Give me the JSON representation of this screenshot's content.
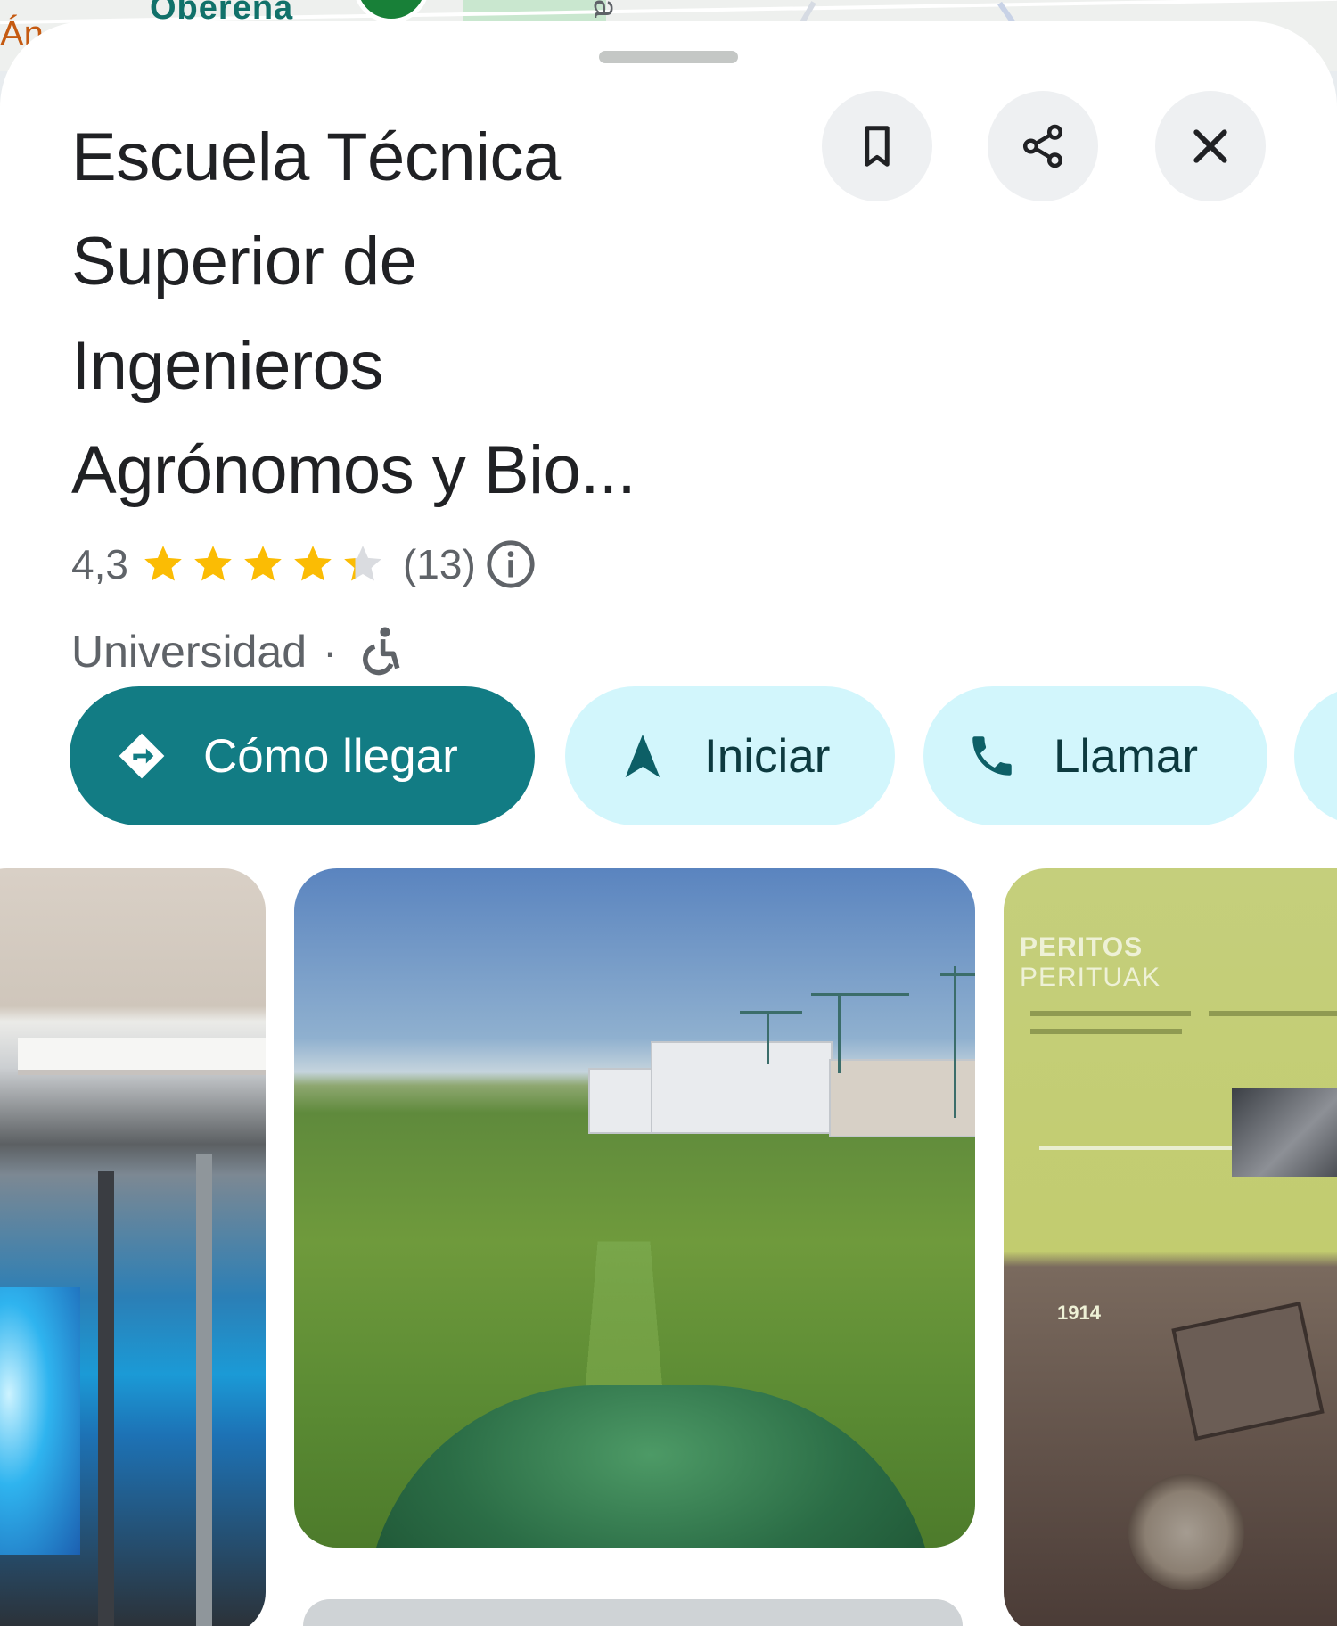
{
  "map": {
    "label_left": "Án",
    "label_street": "Oberena",
    "label_vertical": "a"
  },
  "place": {
    "title_lines": [
      "Escuela Técnica",
      "Superior de",
      "Ingenieros",
      "Agrónomos y Bio..."
    ],
    "rating": "4,3",
    "rating_value": 4.3,
    "review_count": "(13)",
    "category": "Universidad",
    "separator": "·",
    "accessibility_icon": "wheelchair-icon"
  },
  "header_actions": {
    "save_icon": "bookmark-icon",
    "share_icon": "share-icon",
    "close_icon": "close-icon"
  },
  "actions": {
    "directions_label": "Cómo llegar",
    "start_label": "Iniciar",
    "call_label": "Llamar"
  },
  "photos": {
    "right_heading_1": "PERITOS",
    "right_heading_2": "PERITUAK",
    "right_year": "1914"
  },
  "colors": {
    "primary": "#127c84",
    "secondary_bg": "#d2f6fc",
    "star": "#fbbc04",
    "star_empty": "#dadce0"
  }
}
